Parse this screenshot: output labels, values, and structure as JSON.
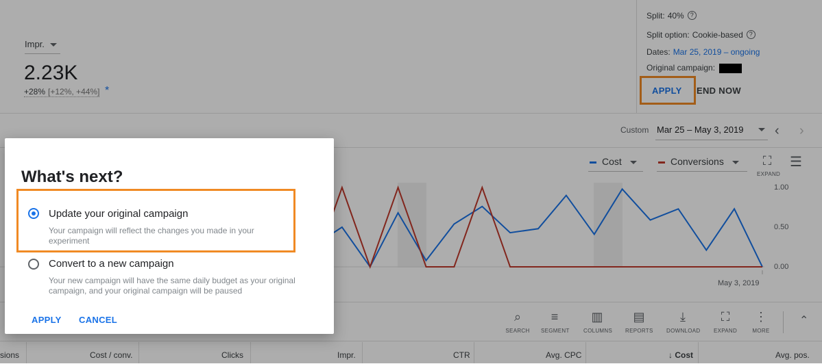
{
  "metric": {
    "selector": "Impr.",
    "value": "2.23K",
    "change": "+28%",
    "range": "[+12%, +44%]",
    "star": "*"
  },
  "experiment": {
    "split_label": "Split:",
    "split_value": "40%",
    "split_option_label": "Split option:",
    "split_option_value": "Cookie-based",
    "dates_label": "Dates:",
    "dates_value": "Mar 25, 2019 – ongoing",
    "original_label": "Original campaign:",
    "apply_label": "APPLY",
    "end_now_label": "END NOW"
  },
  "date_bar": {
    "label": "Custom",
    "value": "Mar 25 – May 3, 2019"
  },
  "chart": {
    "legend": [
      "Cost",
      "Conversions"
    ],
    "expand_label": "EXPAND",
    "y_ticks": [
      "1.00",
      "0.50",
      "0.00"
    ],
    "x_end_label": "May 3, 2019",
    "colors": {
      "cost": "#1a73e8",
      "conversions": "#c0392b",
      "accent": "#f08a24"
    }
  },
  "chart_data": {
    "type": "line",
    "ylim": [
      0,
      1
    ],
    "x_end_label": "May 3, 2019",
    "series": [
      {
        "name": "Cost",
        "values": [
          0.27,
          0.5,
          0.0,
          0.68,
          0.08,
          0.54,
          0.76,
          0.43,
          0.48,
          0.9,
          0.41,
          0.98,
          0.59,
          0.73,
          0.21,
          0.73,
          0.0
        ]
      },
      {
        "name": "Conversions",
        "values": [
          0.0,
          1.0,
          0.0,
          1.0,
          0.0,
          0.0,
          1.0,
          0.0,
          0.0,
          0.0,
          0.0,
          0.0,
          0.0,
          0.0,
          0.0,
          0.0,
          0.0
        ]
      }
    ]
  },
  "toolbar": {
    "items": [
      "SEARCH",
      "SEGMENT",
      "COLUMNS",
      "REPORTS",
      "DOWNLOAD",
      "EXPAND",
      "MORE"
    ]
  },
  "table": {
    "headers": [
      "sions",
      "Cost / conv.",
      "Clicks",
      "Impr.",
      "CTR",
      "Avg. CPC",
      "Cost",
      "Avg. pos."
    ]
  },
  "dialog": {
    "title": "What's next?",
    "option1_label": "Update your original campaign",
    "option1_desc": "Your campaign will reflect the changes you made in your experiment",
    "option2_label": "Convert to a new campaign",
    "option2_desc": "Your new campaign will have the same daily budget as your original campaign, and your original campaign will be paused",
    "apply_label": "APPLY",
    "cancel_label": "CANCEL"
  }
}
